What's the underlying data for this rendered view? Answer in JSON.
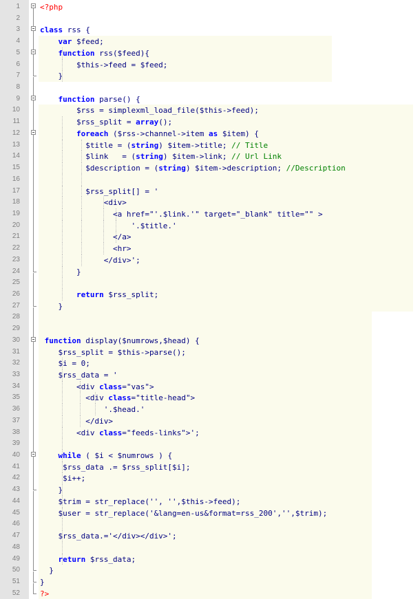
{
  "editor": {
    "lines": [
      {
        "n": "1",
        "text": "<?php"
      },
      {
        "n": "2",
        "text": ""
      },
      {
        "n": "3",
        "text": "class rss {"
      },
      {
        "n": "4",
        "text": "    var $feed;"
      },
      {
        "n": "5",
        "text": "    function rss($feed){"
      },
      {
        "n": "6",
        "text": "        $this->feed = $feed;"
      },
      {
        "n": "7",
        "text": "    }"
      },
      {
        "n": "8",
        "text": ""
      },
      {
        "n": "9",
        "text": "    function parse() {"
      },
      {
        "n": "10",
        "text": "        $rss = simplexml_load_file($this->feed);"
      },
      {
        "n": "11",
        "text": "        $rss_split = array();"
      },
      {
        "n": "12",
        "text": "        foreach ($rss->channel->item as $item) {"
      },
      {
        "n": "13",
        "text": "          $title = (string) $item->title; // Title"
      },
      {
        "n": "14",
        "text": "          $link   = (string) $item->link; // Url Link"
      },
      {
        "n": "15",
        "text": "          $description = (string) $item->description; //Description"
      },
      {
        "n": "16",
        "text": ""
      },
      {
        "n": "17",
        "text": "          $rss_split[] = '"
      },
      {
        "n": "18",
        "text": "              <div>"
      },
      {
        "n": "19",
        "text": "                <a href=\"'.$link.'\" target=\"_blank\" title=\"\" >"
      },
      {
        "n": "20",
        "text": "                    '.$title.'"
      },
      {
        "n": "21",
        "text": "                </a>"
      },
      {
        "n": "22",
        "text": "                <hr>"
      },
      {
        "n": "23",
        "text": "              </div>';"
      },
      {
        "n": "24",
        "text": "        }"
      },
      {
        "n": "25",
        "text": ""
      },
      {
        "n": "26",
        "text": "        return $rss_split;"
      },
      {
        "n": "27",
        "text": "    }"
      },
      {
        "n": "28",
        "text": ""
      },
      {
        "n": "29",
        "text": ""
      },
      {
        "n": "30",
        "text": " function display($numrows,$head) {"
      },
      {
        "n": "31",
        "text": "    $rss_split = $this->parse();"
      },
      {
        "n": "32",
        "text": "    $i = 0;"
      },
      {
        "n": "33",
        "text": "    $rss_data = '"
      },
      {
        "n": "34",
        "text": "        <div class=\"vas\">"
      },
      {
        "n": "35",
        "text": "          <div class=\"title-head\">"
      },
      {
        "n": "36",
        "text": "              '.$head.'"
      },
      {
        "n": "37",
        "text": "          </div>"
      },
      {
        "n": "38",
        "text": "        <div class=\"feeds-links\">';"
      },
      {
        "n": "39",
        "text": ""
      },
      {
        "n": "40",
        "text": "    while ( $i < $numrows ) {"
      },
      {
        "n": "41",
        "text": "     $rss_data .= $rss_split[$i];"
      },
      {
        "n": "42",
        "text": "     $i++;"
      },
      {
        "n": "43",
        "text": "    }"
      },
      {
        "n": "44",
        "text": "    $trim = str_replace('', '',$this->feed);"
      },
      {
        "n": "45",
        "text": "    $user = str_replace('&lang=en-us&format=rss_200','',$trim);"
      },
      {
        "n": "46",
        "text": ""
      },
      {
        "n": "47",
        "text": "    $rss_data.='</div></div>';"
      },
      {
        "n": "48",
        "text": ""
      },
      {
        "n": "49",
        "text": "    return $rss_data;"
      },
      {
        "n": "50",
        "text": "  }"
      },
      {
        "n": "51",
        "text": "}"
      },
      {
        "n": "52",
        "text": "?>"
      }
    ]
  },
  "colors": {
    "gutter": "#e4e4e4",
    "keyword": "#0000ff",
    "variable": "#000080",
    "comment": "#008000",
    "php_tag": "#ff0000",
    "highlight": "#fbfbec"
  }
}
